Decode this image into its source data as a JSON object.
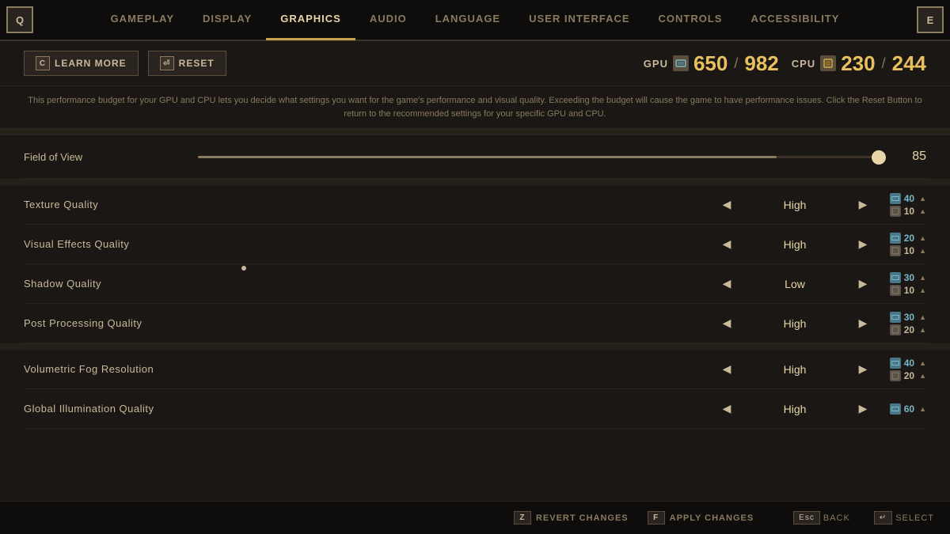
{
  "nav": {
    "left_key": "Q",
    "right_key": "E",
    "tabs": [
      {
        "id": "gameplay",
        "label": "GAMEPLAY",
        "active": false
      },
      {
        "id": "display",
        "label": "DISPLAY",
        "active": false
      },
      {
        "id": "graphics",
        "label": "GRAPHICS",
        "active": true
      },
      {
        "id": "audio",
        "label": "AUDIO",
        "active": false
      },
      {
        "id": "language",
        "label": "LANGUAGE",
        "active": false
      },
      {
        "id": "user-interface",
        "label": "USER INTERFACE",
        "active": false
      },
      {
        "id": "controls",
        "label": "CONTROLS",
        "active": false
      },
      {
        "id": "accessibility",
        "label": "ACCESSIBILITY",
        "active": false
      }
    ]
  },
  "toolbar": {
    "learn_more_key": "C",
    "learn_more_label": "LEARN MORE",
    "reset_key": "⏎",
    "reset_label": "RESET",
    "gpu_label": "GPU",
    "gpu_current": "650",
    "gpu_max": "982",
    "cpu_label": "CPU",
    "cpu_current": "230",
    "cpu_max": "244"
  },
  "description": "This performance budget for your GPU and CPU lets you decide what settings you want for the game's performance and visual quality. Exceeding the budget will cause the game to have performance issues. Click the Reset Button to return to the recommended settings for your specific GPU and CPU.",
  "fov": {
    "label": "Field of View",
    "value": "85",
    "fill_percent": 85
  },
  "settings": [
    {
      "label": "Texture Quality",
      "value": "High",
      "gpu_cost": "40",
      "cpu_cost": "10"
    },
    {
      "label": "Visual Effects Quality",
      "value": "High",
      "gpu_cost": "20",
      "cpu_cost": "10"
    },
    {
      "label": "Shadow Quality",
      "value": "Low",
      "gpu_cost": "30",
      "cpu_cost": "10"
    },
    {
      "label": "Post Processing Quality",
      "value": "High",
      "gpu_cost": "30",
      "cpu_cost": "20"
    }
  ],
  "settings2": [
    {
      "label": "Volumetric Fog Resolution",
      "value": "High",
      "gpu_cost": "40",
      "cpu_cost": "20"
    },
    {
      "label": "Global Illumination Quality",
      "value": "High",
      "gpu_cost": "60",
      "cpu_cost": ""
    }
  ],
  "bottom": {
    "revert_key": "Z",
    "revert_label": "REVERT CHANGES",
    "apply_key": "F",
    "apply_label": "APPLY CHANGES",
    "back_key": "Esc",
    "back_label": "BACK",
    "select_key": "↵",
    "select_label": "SELECT"
  }
}
